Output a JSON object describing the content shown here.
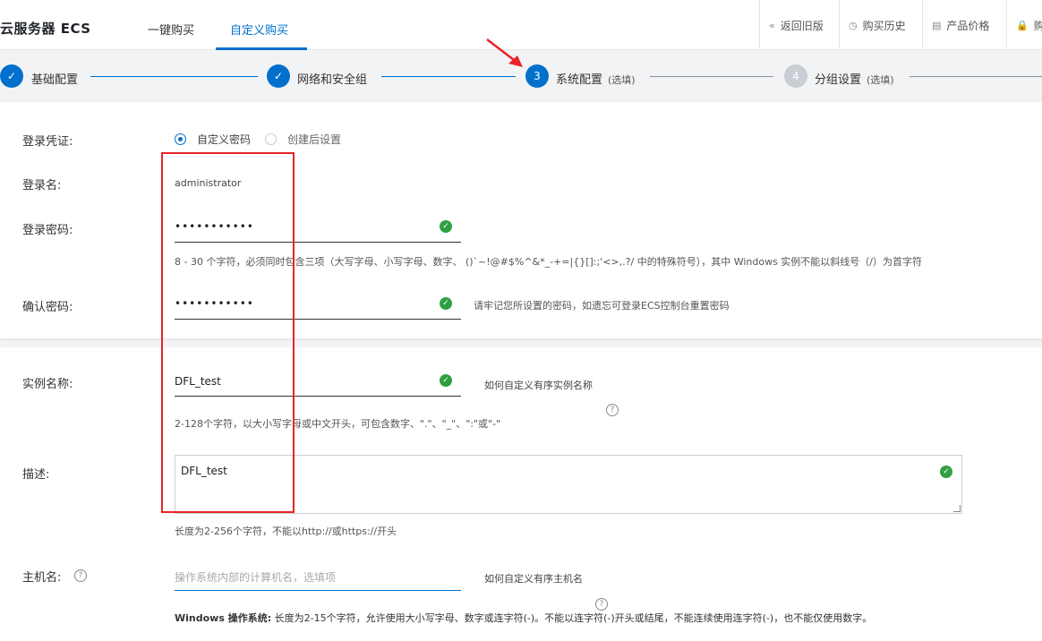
{
  "header": {
    "brand": "云服务器 ECS",
    "tabs": [
      {
        "label": "一键购买"
      },
      {
        "label": "自定义购买"
      }
    ],
    "links": [
      {
        "icon": "double-chevron-left-icon",
        "glyph": "«",
        "label": "返回旧版"
      },
      {
        "icon": "clock-icon",
        "glyph": "◷",
        "label": "购买历史"
      },
      {
        "icon": "list-icon",
        "glyph": "▤",
        "label": "产品价格"
      },
      {
        "icon": "lock-icon",
        "glyph": "🔒",
        "label": "购"
      }
    ]
  },
  "steps": [
    {
      "number": "✓",
      "label": "基础配置",
      "optional": "",
      "state": "done"
    },
    {
      "number": "✓",
      "label": "网络和安全组",
      "optional": "",
      "state": "done"
    },
    {
      "number": "3",
      "label": "系统配置",
      "optional": "(选填)",
      "state": "active"
    },
    {
      "number": "4",
      "label": "分组设置",
      "optional": "(选填)",
      "state": "todo"
    }
  ],
  "credentials": {
    "label": "登录凭证:",
    "options": [
      {
        "label": "自定义密码",
        "checked": true
      },
      {
        "label": "创建后设置",
        "checked": false
      }
    ]
  },
  "login_name": {
    "label": "登录名:",
    "value": "administrator"
  },
  "password": {
    "label": "登录密码:",
    "value": "•••••••••••",
    "hint": "8 - 30 个字符，必须同时包含三项（大写字母、小写字母、数字、 ()`~!@#$%^&*_-+=|{}[]:;'<>,.?/ 中的特殊符号），其中 Windows 实例不能以斜线号（/）为首字符"
  },
  "confirm_password": {
    "label": "确认密码:",
    "value": "•••••••••••",
    "hint": "请牢记您所设置的密码，如遗忘可登录ECS控制台重置密码"
  },
  "instance_name": {
    "label": "实例名称:",
    "value": "DFL_test",
    "link": "如何自定义有序实例名称",
    "hint": "2-128个字符，以大小写字母或中文开头，可包含数字、\".\"、\"_\"、\":\"或\"-\""
  },
  "description": {
    "label": "描述:",
    "value": "DFL_test",
    "hint": "长度为2-256个字符，不能以http://或https://开头"
  },
  "hostname": {
    "label": "主机名:",
    "placeholder": "操作系统内部的计算机名，选填项",
    "link": "如何自定义有序主机名",
    "note_bold": "Windows 操作系统:",
    "note": " 长度为2-15个字符，允许使用大小写字母、数字或连字符(-)。不能以连字符(-)开头或结尾，不能连续使用连字符(-)，也不能仅使用数字。"
  },
  "colors": {
    "accent": "#0070cc",
    "success": "#2ea043",
    "annotation_red": "#e8242a"
  }
}
